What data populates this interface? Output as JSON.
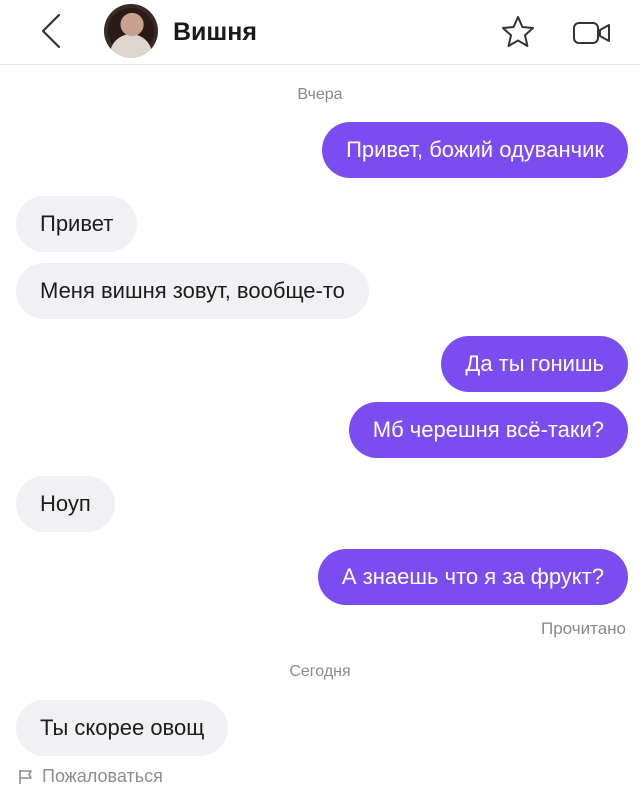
{
  "header": {
    "contact_name": "Вишня",
    "back_icon": "chevron-left-icon",
    "favorite_icon": "star-outline-icon",
    "video_icon": "video-camera-icon"
  },
  "separators": {
    "yesterday": "Вчера",
    "today": "Сегодня"
  },
  "messages": [
    {
      "direction": "out",
      "text": "Привет, божий одуванчик"
    },
    {
      "direction": "in",
      "text": "Привет"
    },
    {
      "direction": "in",
      "text": "Меня вишня зовут, вообще-то"
    },
    {
      "direction": "out",
      "text": "Да ты гонишь"
    },
    {
      "direction": "out",
      "text": "Мб черешня всё-таки?"
    },
    {
      "direction": "in",
      "text": "Ноуп"
    },
    {
      "direction": "out",
      "text": "А знаешь что я за фрукт?"
    },
    {
      "direction": "in",
      "text": "Ты скорее овощ"
    }
  ],
  "read_status": "Прочитано",
  "report_label": "Пожаловаться",
  "colors": {
    "outgoing_bubble": "#7b4cf0",
    "incoming_bubble": "#f1f1f3",
    "meta_text": "#8a8a8a"
  }
}
